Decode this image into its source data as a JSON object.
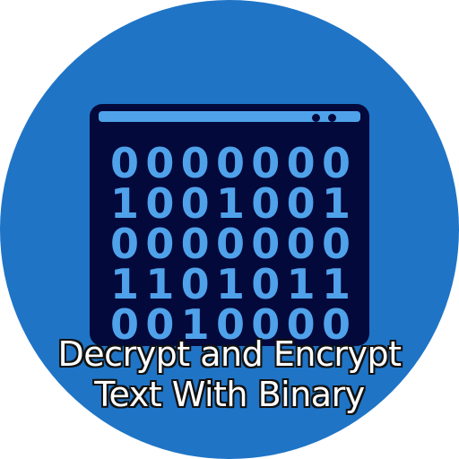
{
  "colors": {
    "badge": "#1f74c6",
    "window": "#04093b",
    "digits": "#4fa2ea",
    "titlebar": "#4fa2ea"
  },
  "icon": "binary-window-icon",
  "binary_rows": [
    [
      "0",
      "0",
      "0",
      "0",
      "0",
      "0",
      "0"
    ],
    [
      "1",
      "0",
      "0",
      "1",
      "0",
      "0",
      "1"
    ],
    [
      "0",
      "0",
      "0",
      "0",
      "0",
      "0",
      "0"
    ],
    [
      "1",
      "1",
      "0",
      "1",
      "0",
      "1",
      "1"
    ],
    [
      "0",
      "0",
      "1",
      "0",
      "0",
      "0",
      "0"
    ]
  ],
  "caption": {
    "line1": "Decrypt and Encrypt",
    "line2": "Text With Binary"
  }
}
